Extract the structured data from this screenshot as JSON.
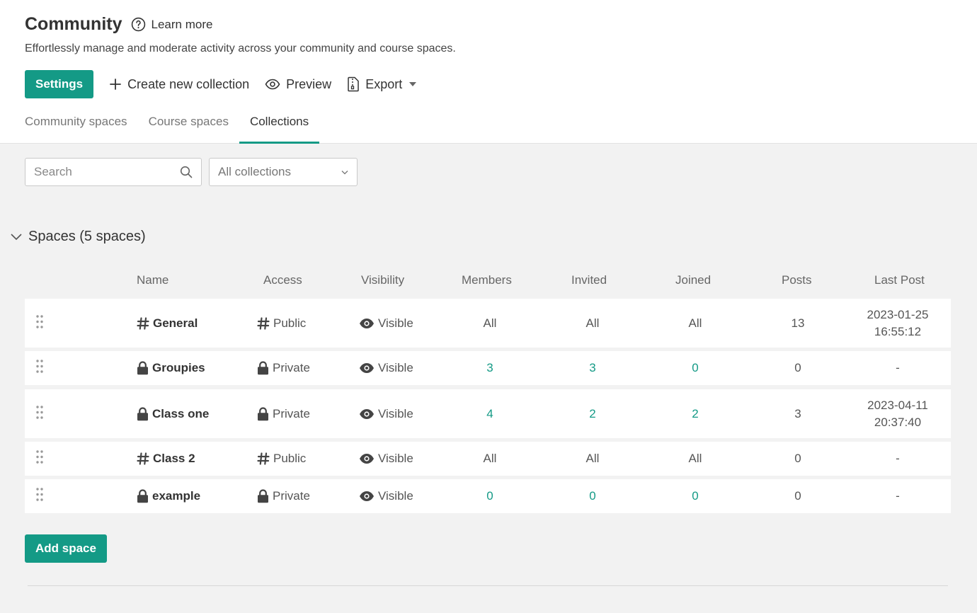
{
  "header": {
    "title": "Community",
    "learn_more": "Learn more",
    "subtitle": "Effortlessly manage and moderate activity across your community and course spaces."
  },
  "toolbar": {
    "settings": "Settings",
    "create": "Create new collection",
    "preview": "Preview",
    "export": "Export"
  },
  "tabs": [
    {
      "label": "Community spaces",
      "active": false
    },
    {
      "label": "Course spaces",
      "active": false
    },
    {
      "label": "Collections",
      "active": true
    }
  ],
  "filters": {
    "search_placeholder": "Search",
    "collection_select": "All collections"
  },
  "section": {
    "title": "Spaces (5 spaces)"
  },
  "columns": {
    "name": "Name",
    "access": "Access",
    "visibility": "Visibility",
    "members": "Members",
    "invited": "Invited",
    "joined": "Joined",
    "posts": "Posts",
    "last_post": "Last Post"
  },
  "rows": [
    {
      "name": "General",
      "icon": "hash-icon",
      "access": "Public",
      "visibility": "Visible",
      "members": "All",
      "invited": "All",
      "joined": "All",
      "posts": "13",
      "last_post_date": "2023-01-25",
      "last_post_time": "16:55:12"
    },
    {
      "name": "Groupies",
      "icon": "lock-icon",
      "access": "Private",
      "visibility": "Visible",
      "members": "3",
      "invited": "3",
      "joined": "0",
      "posts": "0",
      "last_post_date": "-",
      "last_post_time": ""
    },
    {
      "name": "Class one",
      "icon": "lock-icon",
      "access": "Private",
      "visibility": "Visible",
      "members": "4",
      "invited": "2",
      "joined": "2",
      "posts": "3",
      "last_post_date": "2023-04-11",
      "last_post_time": "20:37:40"
    },
    {
      "name": "Class 2",
      "icon": "hash-icon",
      "access": "Public",
      "visibility": "Visible",
      "members": "All",
      "invited": "All",
      "joined": "All",
      "posts": "0",
      "last_post_date": "-",
      "last_post_time": ""
    },
    {
      "name": "example",
      "icon": "lock-icon",
      "access": "Private",
      "visibility": "Visible",
      "members": "0",
      "invited": "0",
      "joined": "0",
      "posts": "0",
      "last_post_date": "-",
      "last_post_time": ""
    }
  ],
  "footer": {
    "add_space": "Add space"
  },
  "colors": {
    "accent": "#149a86",
    "background": "#f2f2f2"
  }
}
